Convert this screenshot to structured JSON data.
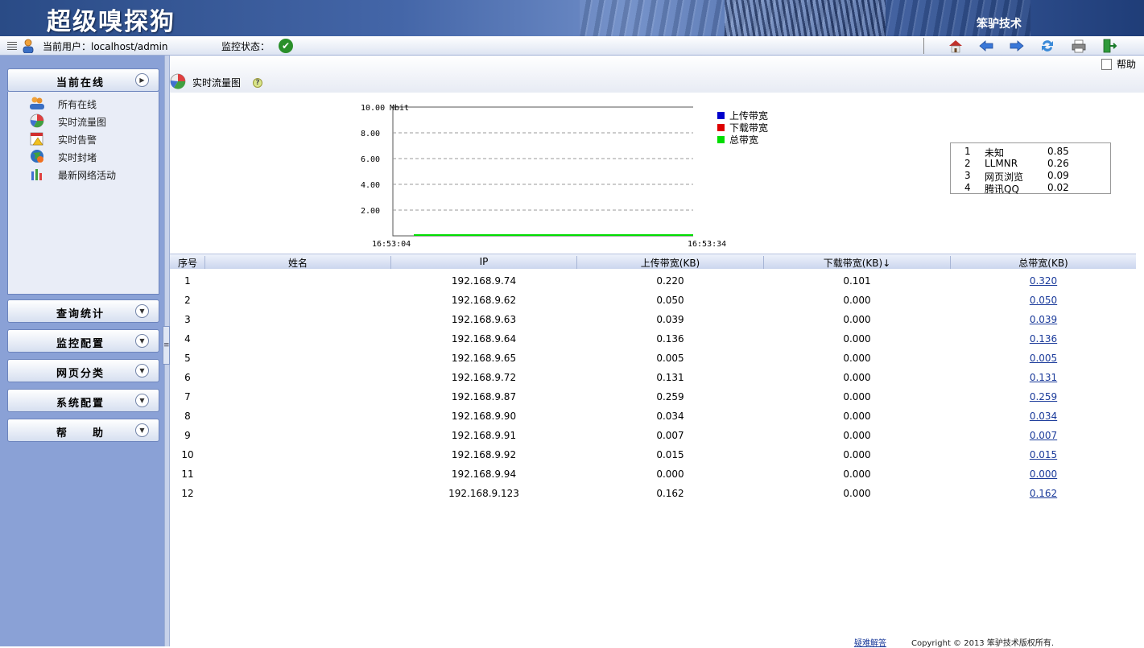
{
  "banner": {
    "app_title": "超级嗅探狗",
    "company": "笨驴技术"
  },
  "toolbar": {
    "current_user": "当前用户：localhost/admin",
    "monitor_status": "监控状态："
  },
  "sidebar": {
    "sections": [
      {
        "label": "当前在线"
      },
      {
        "label": "查询统计"
      },
      {
        "label": "监控配置"
      },
      {
        "label": "网页分类"
      },
      {
        "label": "系统配置"
      },
      {
        "label": "帮　　助"
      }
    ],
    "items": [
      {
        "label": "所有在线"
      },
      {
        "label": "实时流量图"
      },
      {
        "label": "实时告警"
      },
      {
        "label": "实时封堵"
      },
      {
        "label": "最新网络活动"
      }
    ]
  },
  "page": {
    "title": "实时流量图",
    "help_label": "帮助"
  },
  "chart_data": {
    "type": "line",
    "ylabel": "Mbit",
    "yticks": [
      "2.00",
      "4.00",
      "6.00",
      "8.00",
      "10.00"
    ],
    "ylim": [
      0,
      10
    ],
    "x": [
      "16:53:04",
      "16:53:34"
    ],
    "xticks": [
      "16:53:04",
      "16:53:34"
    ],
    "grid": true,
    "legend_position": "right",
    "series": [
      {
        "name": "上传带宽",
        "color": "#0000cc",
        "values": [
          0,
          0
        ]
      },
      {
        "name": "下载带宽",
        "color": "#dd0000",
        "values": [
          0,
          0
        ]
      },
      {
        "name": "总带宽",
        "color": "#00dd00",
        "values": [
          0,
          0
        ]
      }
    ]
  },
  "ranking": [
    {
      "rank": "1",
      "name": "未知",
      "value": "0.85"
    },
    {
      "rank": "2",
      "name": "LLMNR",
      "value": "0.26"
    },
    {
      "rank": "3",
      "name": "网页浏览",
      "value": "0.09"
    },
    {
      "rank": "4",
      "name": "腾讯QQ",
      "value": "0.02"
    }
  ],
  "table": {
    "columns": [
      "序号",
      "姓名",
      "IP",
      "上传带宽(KB)",
      "下载带宽(KB)↓",
      "总带宽(KB)"
    ],
    "rows": [
      {
        "no": "1",
        "name": "",
        "ip": "192.168.9.74",
        "up": "0.220",
        "down": "0.101",
        "total": "0.320"
      },
      {
        "no": "2",
        "name": "",
        "ip": "192.168.9.62",
        "up": "0.050",
        "down": "0.000",
        "total": "0.050"
      },
      {
        "no": "3",
        "name": "",
        "ip": "192.168.9.63",
        "up": "0.039",
        "down": "0.000",
        "total": "0.039"
      },
      {
        "no": "4",
        "name": "",
        "ip": "192.168.9.64",
        "up": "0.136",
        "down": "0.000",
        "total": "0.136"
      },
      {
        "no": "5",
        "name": "",
        "ip": "192.168.9.65",
        "up": "0.005",
        "down": "0.000",
        "total": "0.005"
      },
      {
        "no": "6",
        "name": "",
        "ip": "192.168.9.72",
        "up": "0.131",
        "down": "0.000",
        "total": "0.131"
      },
      {
        "no": "7",
        "name": "",
        "ip": "192.168.9.87",
        "up": "0.259",
        "down": "0.000",
        "total": "0.259"
      },
      {
        "no": "8",
        "name": "",
        "ip": "192.168.9.90",
        "up": "0.034",
        "down": "0.000",
        "total": "0.034"
      },
      {
        "no": "9",
        "name": "",
        "ip": "192.168.9.91",
        "up": "0.007",
        "down": "0.000",
        "total": "0.007"
      },
      {
        "no": "10",
        "name": "",
        "ip": "192.168.9.92",
        "up": "0.015",
        "down": "0.000",
        "total": "0.015"
      },
      {
        "no": "11",
        "name": "",
        "ip": "192.168.9.94",
        "up": "0.000",
        "down": "0.000",
        "total": "0.000"
      },
      {
        "no": "12",
        "name": "",
        "ip": "192.168.9.123",
        "up": "0.162",
        "down": "0.000",
        "total": "0.162"
      }
    ]
  },
  "footer": {
    "faq": "疑难解答",
    "copyright": "Copyright © 2013   笨驴技术版权所有."
  }
}
